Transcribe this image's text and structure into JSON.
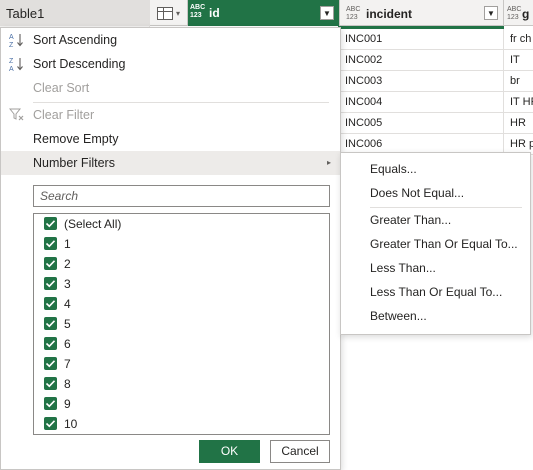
{
  "queries_pane": {
    "selected_query": "Table1"
  },
  "grid": {
    "columns": [
      {
        "type_label_top": "ABC",
        "type_label_bottom": "123",
        "name": "id"
      },
      {
        "type_label_top": "ABC",
        "type_label_bottom": "123",
        "name": "incident"
      },
      {
        "type_label_top": "ABC",
        "type_label_bottom": "123",
        "name": "g"
      }
    ],
    "rows": [
      {
        "id": "INC001",
        "incident": "fr ch t"
      },
      {
        "id": "INC002",
        "incident": "IT"
      },
      {
        "id": "INC003",
        "incident": "br"
      },
      {
        "id": "INC004",
        "incident": "IT HR"
      },
      {
        "id": "INC005",
        "incident": "HR"
      },
      {
        "id": "INC006",
        "incident": "HR pt"
      }
    ]
  },
  "filter_menu": {
    "sort_ascending": "Sort Ascending",
    "sort_descending": "Sort Descending",
    "clear_sort": "Clear Sort",
    "clear_filter": "Clear Filter",
    "remove_empty": "Remove Empty",
    "number_filters": "Number Filters",
    "search_placeholder": "Search",
    "values": [
      "(Select All)",
      "1",
      "2",
      "3",
      "4",
      "5",
      "6",
      "7",
      "8",
      "9",
      "10"
    ],
    "ok_label": "OK",
    "cancel_label": "Cancel"
  },
  "number_filters_submenu": {
    "equals": "Equals...",
    "not_equal": "Does Not Equal...",
    "greater_than": "Greater Than...",
    "greater_or_equal": "Greater Than Or Equal To...",
    "less_than": "Less Than...",
    "less_or_equal": "Less Than Or Equal To...",
    "between": "Between..."
  },
  "colors": {
    "accent": "#217346",
    "hover": "#edebe9",
    "disabled_text": "#a19f9d"
  }
}
